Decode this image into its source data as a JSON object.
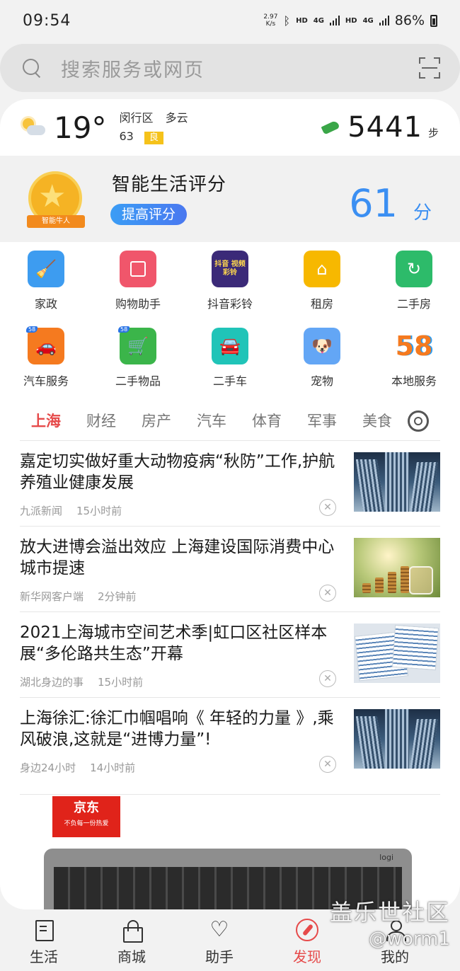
{
  "status": {
    "time": "09:54",
    "speed_value": "2.97",
    "speed_unit": "K/s",
    "hd1": "HD",
    "net1": "4G",
    "hd2": "HD",
    "net2": "4G",
    "battery": "86%"
  },
  "search": {
    "placeholder": "搜索服务或网页"
  },
  "weather": {
    "temperature": "19°",
    "district": "闵行区",
    "condition": "多云",
    "aqi_value": "63",
    "aqi_label": "良",
    "icon": "partly-cloudy-icon"
  },
  "steps": {
    "value": "5441",
    "unit": "步",
    "icon": "shoe-icon"
  },
  "score": {
    "title": "智能生活评分",
    "button": "提高评分",
    "medal_label": "智能牛人",
    "value": "61",
    "unit": "分"
  },
  "services": [
    [
      {
        "label": "家政",
        "icon": "broom-icon",
        "color": "#3d9cf0"
      },
      {
        "label": "购物助手",
        "icon": "shopping-bag-icon",
        "color": "#f0566b"
      },
      {
        "label": "抖音彩铃",
        "icon": "douyin-ringtone-icon",
        "color": "#3b2a78",
        "tile_text": "抖音 视频彩铃"
      },
      {
        "label": "租房",
        "icon": "house-icon",
        "color": "#f7b800"
      },
      {
        "label": "二手房",
        "icon": "second-hand-house-icon",
        "color": "#2dbb6a"
      }
    ],
    [
      {
        "label": "汽车服务",
        "icon": "car-service-icon",
        "color": "#f57a1f",
        "badge": "58"
      },
      {
        "label": "二手物品",
        "icon": "shopping-cart-icon",
        "color": "#3bb54a",
        "badge": "58"
      },
      {
        "label": "二手车",
        "icon": "car-icon",
        "color": "#20c4b8"
      },
      {
        "label": "宠物",
        "icon": "dog-icon",
        "color": "#63a6f5"
      },
      {
        "label": "本地服务",
        "icon": "58-logo-icon",
        "color": "#ffffff",
        "tile_text": "58"
      }
    ]
  ],
  "channels": [
    "上海",
    "财经",
    "房产",
    "汽车",
    "体育",
    "军事",
    "美食"
  ],
  "news": [
    {
      "title": "嘉定切实做好重大动物疫病“秋防”工作,护航养殖业健康发展",
      "source": "九派新闻",
      "time": "15小时前",
      "thumb": "tower"
    },
    {
      "title": "放大进博会溢出效应 上海建设国际消费中心城市提速",
      "source": "新华网客户端",
      "time": "2分钟前",
      "thumb": "coins"
    },
    {
      "title": "2021上海城市空间艺术季|虹口区社区样本展“多伦路共生态”开幕",
      "source": "湖北身边的事",
      "time": "15小时前",
      "thumb": "brochure"
    },
    {
      "title": "上海徐汇:徐汇巾帼唱响《 年轻的力量 》,乘风破浪,这就是“进博力量”!",
      "source": "身边24小时",
      "time": "14小时前",
      "thumb": "tower"
    }
  ],
  "ad": {
    "logo": "京东",
    "slogan": "不负每一份热爱",
    "product_brand": "logi"
  },
  "nav": [
    {
      "label": "生活",
      "icon": "life-icon"
    },
    {
      "label": "商城",
      "icon": "mall-icon"
    },
    {
      "label": "助手",
      "icon": "heart-icon"
    },
    {
      "label": "发现",
      "icon": "compass-icon",
      "active": true
    },
    {
      "label": "我的",
      "icon": "person-icon"
    }
  ],
  "watermark": {
    "line1": "盖乐世社区",
    "line2": "@worm1"
  },
  "colors": {
    "accent_red": "#e64a4a",
    "score_blue": "#3b8ff2",
    "aqi_yellow": "#f5c21a",
    "step_green": "#3aa648"
  }
}
